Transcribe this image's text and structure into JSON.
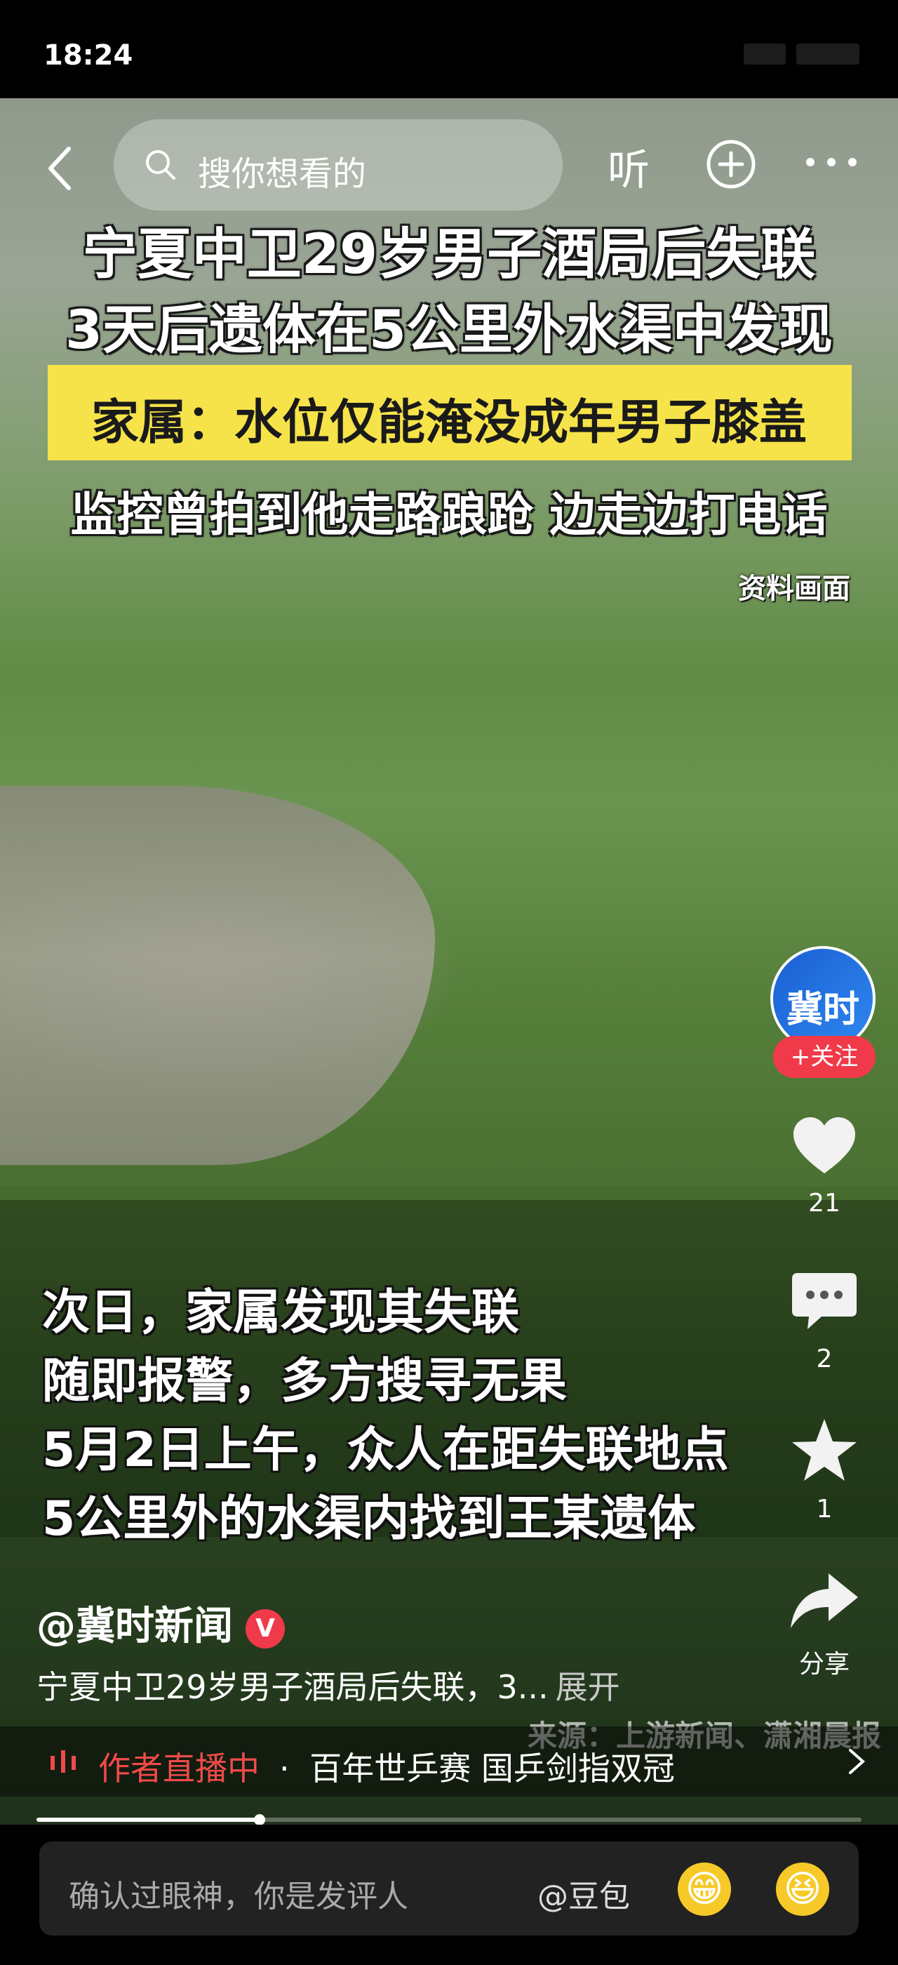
{
  "status_bar": {
    "time": "18:24"
  },
  "top_nav": {
    "search_placeholder": "搜你想看的",
    "listen_label": "听"
  },
  "video_overlay": {
    "headline_1": "宁夏中卫29岁男子酒局后失联",
    "headline_2": "3天后遗体在5公里外水渠中发现",
    "highlight": "家属：水位仅能淹没成年男子膝盖",
    "headline_3": "监控曾拍到他走路踉跄  边走边打电话",
    "footage_tag": "资料画面",
    "caption_lines": [
      "次日，家属发现其失联",
      "随即报警，多方搜寻无果",
      "5月2日上午，众人在距失联地点",
      "5公里外的水渠内找到王某遗体"
    ],
    "source_watermark": "来源：上游新闻、潇湘晨报"
  },
  "right_rail": {
    "avatar_text": "冀时",
    "follow_label": "+关注",
    "likes": "21",
    "comments": "2",
    "favorites": "1",
    "share_label": "分享"
  },
  "post": {
    "author": "@冀时新闻",
    "verified_mark": "V",
    "description": "宁夏中卫29岁男子酒局后失联，3...",
    "expand_label": "展开"
  },
  "live_bar": {
    "status": "作者直播中",
    "separator": "·",
    "text": "百年世乒赛 国乒剑指双冠"
  },
  "progress": {
    "played_fraction": 0.27
  },
  "comment_bar": {
    "placeholder": "确认过眼神，你是发评人",
    "mention": "@豆包",
    "emoji_1": "😁",
    "emoji_2": "😆"
  },
  "colors": {
    "accent_red": "#f03a4a",
    "highlight_yellow": "#f6e34a"
  }
}
